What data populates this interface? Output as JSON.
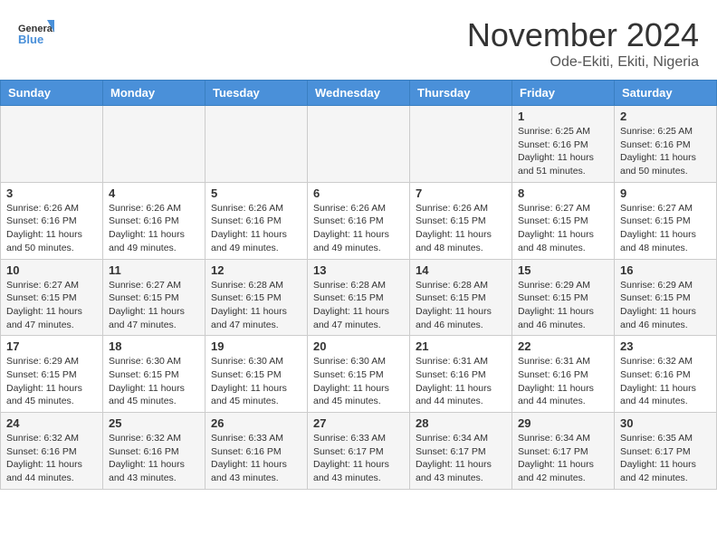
{
  "header": {
    "logo_line1": "General",
    "logo_line2": "Blue",
    "month_title": "November 2024",
    "subtitle": "Ode-Ekiti, Ekiti, Nigeria"
  },
  "weekdays": [
    "Sunday",
    "Monday",
    "Tuesday",
    "Wednesday",
    "Thursday",
    "Friday",
    "Saturday"
  ],
  "weeks": [
    [
      {
        "day": "",
        "info": ""
      },
      {
        "day": "",
        "info": ""
      },
      {
        "day": "",
        "info": ""
      },
      {
        "day": "",
        "info": ""
      },
      {
        "day": "",
        "info": ""
      },
      {
        "day": "1",
        "info": "Sunrise: 6:25 AM\nSunset: 6:16 PM\nDaylight: 11 hours and 51 minutes."
      },
      {
        "day": "2",
        "info": "Sunrise: 6:25 AM\nSunset: 6:16 PM\nDaylight: 11 hours and 50 minutes."
      }
    ],
    [
      {
        "day": "3",
        "info": "Sunrise: 6:26 AM\nSunset: 6:16 PM\nDaylight: 11 hours and 50 minutes."
      },
      {
        "day": "4",
        "info": "Sunrise: 6:26 AM\nSunset: 6:16 PM\nDaylight: 11 hours and 49 minutes."
      },
      {
        "day": "5",
        "info": "Sunrise: 6:26 AM\nSunset: 6:16 PM\nDaylight: 11 hours and 49 minutes."
      },
      {
        "day": "6",
        "info": "Sunrise: 6:26 AM\nSunset: 6:16 PM\nDaylight: 11 hours and 49 minutes."
      },
      {
        "day": "7",
        "info": "Sunrise: 6:26 AM\nSunset: 6:15 PM\nDaylight: 11 hours and 48 minutes."
      },
      {
        "day": "8",
        "info": "Sunrise: 6:27 AM\nSunset: 6:15 PM\nDaylight: 11 hours and 48 minutes."
      },
      {
        "day": "9",
        "info": "Sunrise: 6:27 AM\nSunset: 6:15 PM\nDaylight: 11 hours and 48 minutes."
      }
    ],
    [
      {
        "day": "10",
        "info": "Sunrise: 6:27 AM\nSunset: 6:15 PM\nDaylight: 11 hours and 47 minutes."
      },
      {
        "day": "11",
        "info": "Sunrise: 6:27 AM\nSunset: 6:15 PM\nDaylight: 11 hours and 47 minutes."
      },
      {
        "day": "12",
        "info": "Sunrise: 6:28 AM\nSunset: 6:15 PM\nDaylight: 11 hours and 47 minutes."
      },
      {
        "day": "13",
        "info": "Sunrise: 6:28 AM\nSunset: 6:15 PM\nDaylight: 11 hours and 47 minutes."
      },
      {
        "day": "14",
        "info": "Sunrise: 6:28 AM\nSunset: 6:15 PM\nDaylight: 11 hours and 46 minutes."
      },
      {
        "day": "15",
        "info": "Sunrise: 6:29 AM\nSunset: 6:15 PM\nDaylight: 11 hours and 46 minutes."
      },
      {
        "day": "16",
        "info": "Sunrise: 6:29 AM\nSunset: 6:15 PM\nDaylight: 11 hours and 46 minutes."
      }
    ],
    [
      {
        "day": "17",
        "info": "Sunrise: 6:29 AM\nSunset: 6:15 PM\nDaylight: 11 hours and 45 minutes."
      },
      {
        "day": "18",
        "info": "Sunrise: 6:30 AM\nSunset: 6:15 PM\nDaylight: 11 hours and 45 minutes."
      },
      {
        "day": "19",
        "info": "Sunrise: 6:30 AM\nSunset: 6:15 PM\nDaylight: 11 hours and 45 minutes."
      },
      {
        "day": "20",
        "info": "Sunrise: 6:30 AM\nSunset: 6:15 PM\nDaylight: 11 hours and 45 minutes."
      },
      {
        "day": "21",
        "info": "Sunrise: 6:31 AM\nSunset: 6:16 PM\nDaylight: 11 hours and 44 minutes."
      },
      {
        "day": "22",
        "info": "Sunrise: 6:31 AM\nSunset: 6:16 PM\nDaylight: 11 hours and 44 minutes."
      },
      {
        "day": "23",
        "info": "Sunrise: 6:32 AM\nSunset: 6:16 PM\nDaylight: 11 hours and 44 minutes."
      }
    ],
    [
      {
        "day": "24",
        "info": "Sunrise: 6:32 AM\nSunset: 6:16 PM\nDaylight: 11 hours and 44 minutes."
      },
      {
        "day": "25",
        "info": "Sunrise: 6:32 AM\nSunset: 6:16 PM\nDaylight: 11 hours and 43 minutes."
      },
      {
        "day": "26",
        "info": "Sunrise: 6:33 AM\nSunset: 6:16 PM\nDaylight: 11 hours and 43 minutes."
      },
      {
        "day": "27",
        "info": "Sunrise: 6:33 AM\nSunset: 6:17 PM\nDaylight: 11 hours and 43 minutes."
      },
      {
        "day": "28",
        "info": "Sunrise: 6:34 AM\nSunset: 6:17 PM\nDaylight: 11 hours and 43 minutes."
      },
      {
        "day": "29",
        "info": "Sunrise: 6:34 AM\nSunset: 6:17 PM\nDaylight: 11 hours and 42 minutes."
      },
      {
        "day": "30",
        "info": "Sunrise: 6:35 AM\nSunset: 6:17 PM\nDaylight: 11 hours and 42 minutes."
      }
    ]
  ]
}
